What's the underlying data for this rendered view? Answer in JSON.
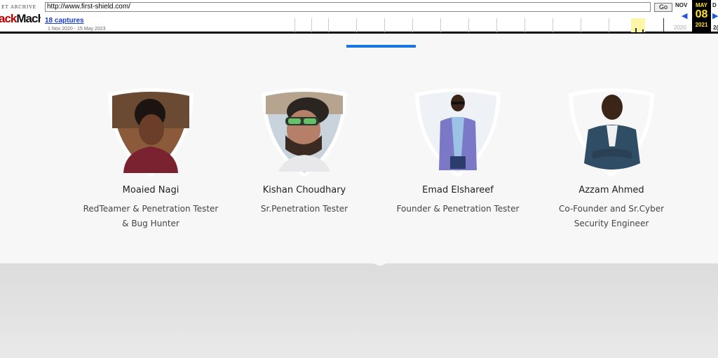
{
  "wayback": {
    "logo_top": "ET ARCHIVE",
    "logo_main_red": "ack",
    "logo_main_dark": "Machine",
    "url": "http://www.first-shield.com/",
    "go_label": "Go",
    "captures": "18 captures",
    "range": "1 Nov 2020 - 15 May 2023",
    "prev_month": "NOV",
    "prev_year": "2020",
    "cur_month": "MAY",
    "cur_day": "08",
    "cur_year": "2021",
    "next_month": "D",
    "next_year": "2("
  },
  "team": {
    "accent_color": "#1976e0",
    "members": [
      {
        "name": "Moaied Nagi",
        "role": "RedTeamer & Penetration Tester & Bug Hunter"
      },
      {
        "name": "Kishan Choudhary",
        "role": "Sr.Penetration Tester"
      },
      {
        "name": "Emad Elshareef",
        "role": "Founder & Penetration Tester"
      },
      {
        "name": "Azzam Ahmed",
        "role": "Co-Founder and Sr.Cyber Security Engineer"
      }
    ]
  }
}
